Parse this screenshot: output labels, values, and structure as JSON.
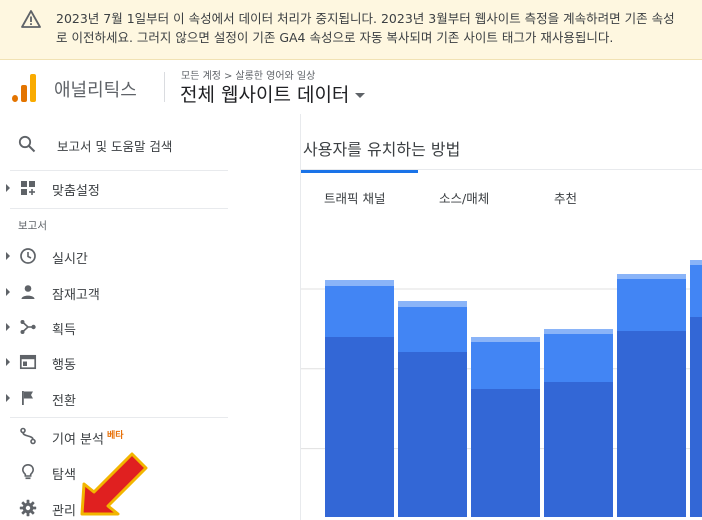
{
  "banner": {
    "icon": "warning-icon",
    "line1": "2023년 7월 1일부터 이 속성에서 데이터 처리가 중지됩니다. 2023년 3월부터 웹사이트 측정을 계속하려면 기존 속성",
    "line2": "로 이전하세요. 그러지 않으면 설정이 기존 GA4 속성으로 자동 복사되며 기존 사이트 태그가 재사용됩니다.",
    "bg_color": "#fef7e0"
  },
  "header": {
    "app_name": "애널리틱스",
    "breadcrumb": {
      "root": "모든 계정",
      "separator": ">",
      "account": "살롱한 영어와 일상"
    },
    "property_title": "전체 웹사이트 데이터"
  },
  "sidebar": {
    "search_label": "보고서 및 도움말 검색",
    "section_label": "보고서",
    "items": [
      {
        "id": "customization",
        "label": "맞춤설정",
        "icon": "dashboard-add-icon"
      },
      {
        "id": "realtime",
        "label": "실시간",
        "icon": "clock-icon"
      },
      {
        "id": "audience",
        "label": "잠재고객",
        "icon": "person-icon"
      },
      {
        "id": "acquisition",
        "label": "획득",
        "icon": "acquisition-icon"
      },
      {
        "id": "behavior",
        "label": "행동",
        "icon": "behavior-icon"
      },
      {
        "id": "conversions",
        "label": "전환",
        "icon": "flag-icon"
      }
    ],
    "attribution": {
      "label": "기여 분석",
      "badge": "베타",
      "icon": "attribution-icon"
    },
    "discover": {
      "label": "탐색",
      "icon": "lightbulb-icon"
    },
    "admin": {
      "label": "관리",
      "icon": "gear-icon"
    }
  },
  "main": {
    "card_title": "사용자를 유치하는 방법",
    "tabs": [
      "트래픽 채널",
      "소스/매체",
      "추천"
    ],
    "active_tab": 0,
    "accent_color": "#1a73e8"
  },
  "annotation": {
    "icon": "red-arrow-icon",
    "color": "#e02020"
  },
  "chart_data": {
    "type": "bar",
    "stacked": true,
    "grid": true,
    "series_colors": [
      "#3367d6",
      "#4285f4",
      "#8ab4f8"
    ],
    "series": [
      {
        "values": [
          180,
          165,
          128,
          135,
          186,
          200
        ]
      },
      {
        "values": [
          51,
          45,
          47,
          48,
          52,
          52
        ]
      },
      {
        "values": [
          6,
          6,
          5,
          5,
          5,
          5
        ]
      }
    ],
    "ylim": [
      0,
      285
    ]
  }
}
